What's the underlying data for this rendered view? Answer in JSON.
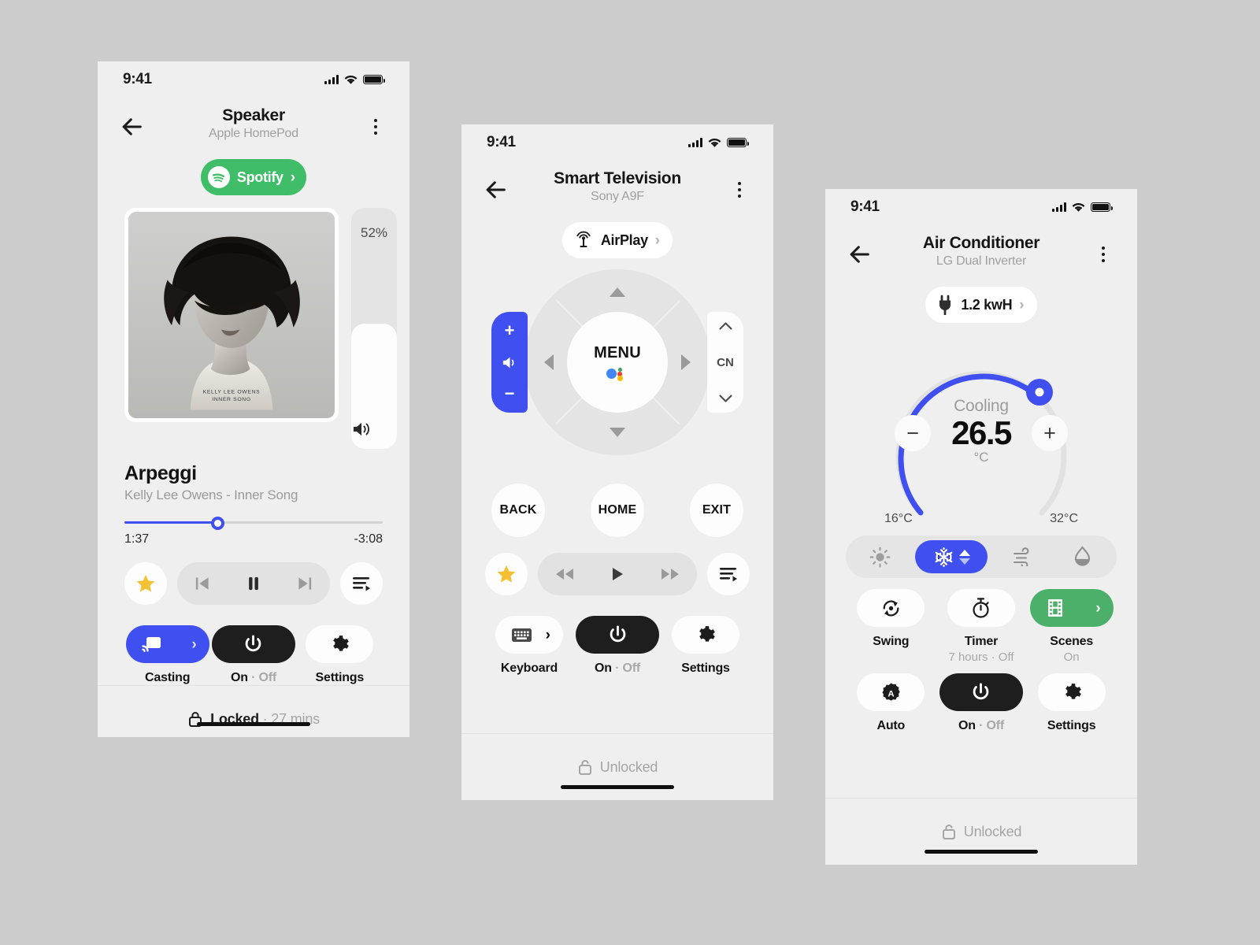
{
  "theme": {
    "page_bg": "#cccccc",
    "screen_bg": "#efefef",
    "accent_blue": "#4050f0",
    "spotify_green": "#3fbd69",
    "scenes_green": "#4cb06b",
    "dark": "#1e1e1e",
    "star_yellow": "#f5c033"
  },
  "speaker": {
    "status": {
      "time": "9:41"
    },
    "header": {
      "title": "Speaker",
      "subtitle": "Apple HomePod",
      "back_icon": "arrow-left-icon",
      "menu_icon": "kebab-menu-icon"
    },
    "source_pill": {
      "label": "Spotify",
      "icon": "spotify-icon",
      "chevron": "›"
    },
    "album": {
      "art_line1": "KELLY LEE OWENS",
      "art_line2": "INNER SONG"
    },
    "volume": {
      "percent_label": "52%",
      "percent_value": 52,
      "icon": "speaker-volume-icon"
    },
    "now_playing": {
      "title": "Arpeggi",
      "subtitle": "Kelly Lee Owens - Inner Song",
      "elapsed": "1:37",
      "remaining": "-3:08",
      "progress_percent": 36
    },
    "media_controls": {
      "favorite_icon": "star-icon",
      "previous_icon": "skip-previous-icon",
      "playpause_icon": "pause-icon",
      "next_icon": "skip-next-icon",
      "queue_icon": "playlist-queue-icon"
    },
    "actions": [
      {
        "label": "Casting",
        "icon": "cast-icon",
        "style": "blue",
        "chevron": "›"
      },
      {
        "label_on": "On",
        "label_sep": " · ",
        "label_off": "Off",
        "icon": "power-icon",
        "style": "dark"
      },
      {
        "label": "Settings",
        "icon": "gear-icon",
        "style": "white"
      }
    ],
    "footer": {
      "icon": "lock-closed-icon",
      "text": "Locked",
      "separator": " · ",
      "detail": "27 mins"
    }
  },
  "tv": {
    "status": {
      "time": "9:41"
    },
    "header": {
      "title": "Smart Television",
      "subtitle": "Sony A9F",
      "back_icon": "arrow-left-icon",
      "menu_icon": "kebab-menu-icon"
    },
    "source_pill": {
      "label": "AirPlay",
      "icon": "airplay-icon",
      "chevron": "›"
    },
    "dpad": {
      "center_label": "MENU",
      "assistant_icon": "google-assistant-icon",
      "up_icon": "triangle-up-icon",
      "down_icon": "triangle-down-icon",
      "left_icon": "triangle-left-icon",
      "right_icon": "triangle-right-icon",
      "volume_rocker": {
        "plus": "+",
        "minus": "−",
        "icon": "speaker-volume-icon"
      },
      "channel_rocker": {
        "label": "CN",
        "up": "chevron-up-icon",
        "down": "chevron-down-icon"
      }
    },
    "nav_buttons": [
      {
        "label": "BACK"
      },
      {
        "label": "HOME"
      },
      {
        "label": "EXIT"
      }
    ],
    "media_controls": {
      "favorite_icon": "star-icon",
      "rewind_icon": "fast-rewind-icon",
      "play_icon": "play-icon",
      "forward_icon": "fast-forward-icon",
      "queue_icon": "playlist-queue-icon"
    },
    "actions": [
      {
        "label": "Keyboard",
        "icon": "keyboard-icon",
        "style": "white",
        "chevron": "›"
      },
      {
        "label_on": "On",
        "label_sep": " · ",
        "label_off": "Off",
        "icon": "power-icon",
        "style": "dark"
      },
      {
        "label": "Settings",
        "icon": "gear-icon",
        "style": "white"
      }
    ],
    "footer": {
      "icon": "lock-open-icon",
      "text": "Unlocked"
    }
  },
  "ac": {
    "status": {
      "time": "9:41"
    },
    "header": {
      "title": "Air Conditioner",
      "subtitle": "LG Dual Inverter",
      "back_icon": "arrow-left-icon",
      "menu_icon": "kebab-menu-icon"
    },
    "source_pill": {
      "label": "1.2 kwH",
      "icon": "power-plug-icon",
      "chevron": "›"
    },
    "dial": {
      "mode_label": "Cooling",
      "temperature": "26.5",
      "unit": "°C",
      "min_label": "16°C",
      "max_label": "32°C",
      "min_value": 16,
      "max_value": 32,
      "current_value": 26.5,
      "decrease_icon": "minus-icon",
      "increase_icon": "plus-icon",
      "arc_color": "#4050f0"
    },
    "modes": [
      {
        "name": "heat",
        "icon": "sun-icon",
        "active": false
      },
      {
        "name": "cool",
        "icon": "snowflake-icon",
        "active": true,
        "stepper_icon": "up-down-stepper-icon"
      },
      {
        "name": "fan",
        "icon": "wind-icon",
        "active": false
      },
      {
        "name": "dry",
        "icon": "droplet-icon",
        "active": false
      }
    ],
    "actions": [
      {
        "label": "Swing",
        "icon": "swing-rotate-icon",
        "style": "white"
      },
      {
        "label": "Timer",
        "icon": "timer-icon",
        "style": "white",
        "sub": "7 hours · Off"
      },
      {
        "label": "Scenes",
        "icon": "scenes-film-icon",
        "style": "green",
        "sub": "On",
        "chevron": "›"
      },
      {
        "label": "Auto",
        "icon": "auto-a-icon",
        "style": "white"
      },
      {
        "label_on": "On",
        "label_sep": " · ",
        "label_off": "Off",
        "icon": "power-icon",
        "style": "dark"
      },
      {
        "label": "Settings",
        "icon": "gear-icon",
        "style": "white"
      }
    ],
    "footer": {
      "icon": "lock-open-icon",
      "text": "Unlocked"
    }
  }
}
